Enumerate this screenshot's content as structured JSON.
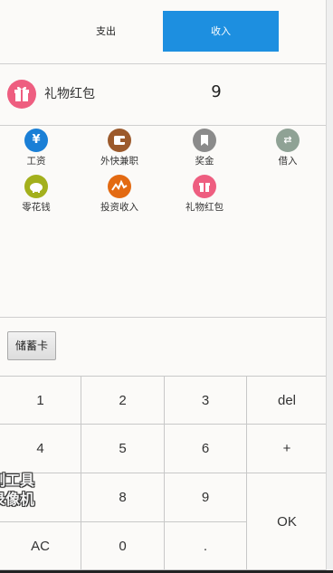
{
  "tabs": {
    "expense": "支出",
    "income": "收入"
  },
  "entry": {
    "category": "礼物红包",
    "amount": "9"
  },
  "categories": [
    {
      "label": "工资",
      "icon": "yen-icon",
      "color": "#1a7fd6"
    },
    {
      "label": "外快兼职",
      "icon": "wallet-icon",
      "color": "#9c5a2c"
    },
    {
      "label": "奖金",
      "icon": "bookmark-icon",
      "color": "#8b8b8b"
    },
    {
      "label": "借入",
      "icon": "transfer-icon",
      "color": "#8fa295"
    },
    {
      "label": "零花钱",
      "icon": "piggy-bank-icon",
      "color": "#a3b01c"
    },
    {
      "label": "投资收入",
      "icon": "trend-chart-icon",
      "color": "#e36a12"
    },
    {
      "label": "礼物红包",
      "icon": "gift-icon",
      "color": "#ee5e80"
    }
  ],
  "account": {
    "label": "储蓄卡"
  },
  "keypad": {
    "k1": "1",
    "k2": "2",
    "k3": "3",
    "del": "del",
    "k4": "4",
    "k5": "5",
    "k6": "6",
    "plus": "+",
    "k8": "8",
    "k9": "9",
    "ok": "OK",
    "ac": "AC",
    "k0": "0",
    "dot": "."
  },
  "watermark": {
    "line1": "制工具",
    "line2": "录像机"
  }
}
